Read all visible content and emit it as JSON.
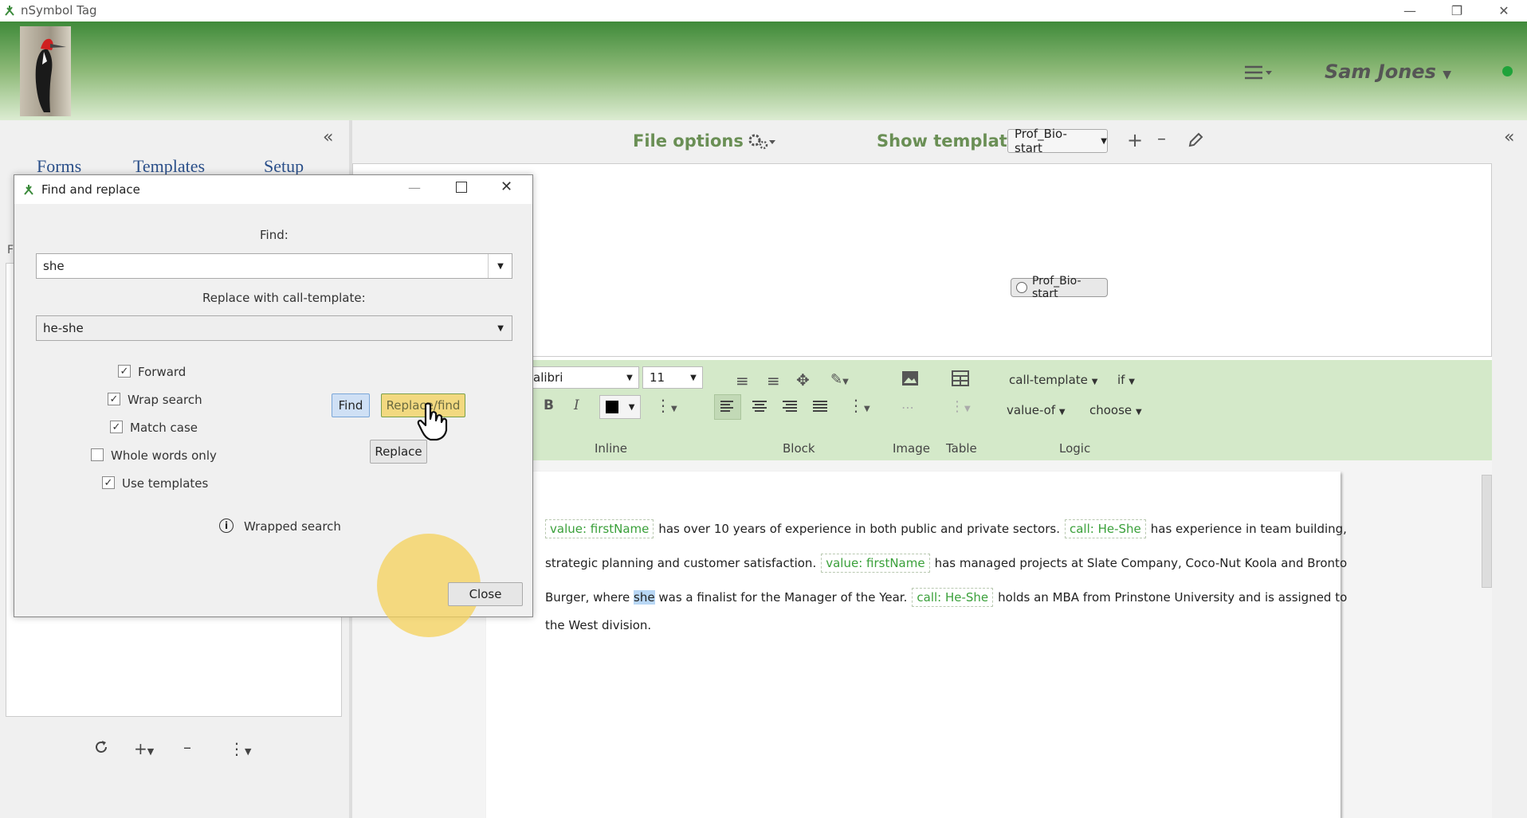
{
  "window": {
    "title": "nSymbol Tag"
  },
  "header": {
    "user_name": "Sam Jones",
    "status_color": "#1fa33a"
  },
  "left_panel": {
    "tabs": [
      "Forms",
      "Templates",
      "Setup"
    ],
    "partial_label": "F"
  },
  "toolbar": {
    "file_options": "File options",
    "show_template": "Show template",
    "template_value": "Prof_Bio-start"
  },
  "template_area": {
    "node_label": "Prof_Bio-start"
  },
  "ribbon": {
    "font_name": "alibri",
    "font_size": "11",
    "call_template": "call-template",
    "if": "if",
    "value_of": "value-of",
    "choose": "choose",
    "groups": {
      "inline": "Inline",
      "block": "Block",
      "image": "Image",
      "table": "Table",
      "logic": "Logic"
    }
  },
  "editor": {
    "line1": {
      "tag1": "value: firstName",
      "text1": "has over 10 years of experience in both public and private sectors.",
      "tag2": "call: He-She",
      "text2": "has experience in team building,"
    },
    "line2": {
      "text1": "strategic planning and customer satisfaction.",
      "tag1": "value: firstName",
      "text2": "has managed projects at Slate Company, Coco-Nut Koola and Bronto"
    },
    "line3": {
      "text1": "Burger, where",
      "highlight": "she",
      "text2": "was a finalist for the Manager of the Year.",
      "tag1": "call: He-She",
      "text3": "holds an MBA from Prinstone University and is assigned to"
    },
    "line4": {
      "text1": "the West division."
    }
  },
  "dialog": {
    "title": "Find and replace",
    "find_label": "Find:",
    "find_value": "she",
    "replace_label": "Replace with call-template:",
    "replace_value": "he-she",
    "options": {
      "forward": "Forward",
      "wrap_search": "Wrap search",
      "match_case": "Match case",
      "whole_words": "Whole words only",
      "use_templates": "Use templates"
    },
    "checked": {
      "forward": true,
      "wrap_search": true,
      "match_case": true,
      "whole_words": false,
      "use_templates": true
    },
    "buttons": {
      "find": "Find",
      "replace_find": "Replace/find",
      "replace": "Replace",
      "close": "Close"
    },
    "status": "Wrapped search"
  }
}
